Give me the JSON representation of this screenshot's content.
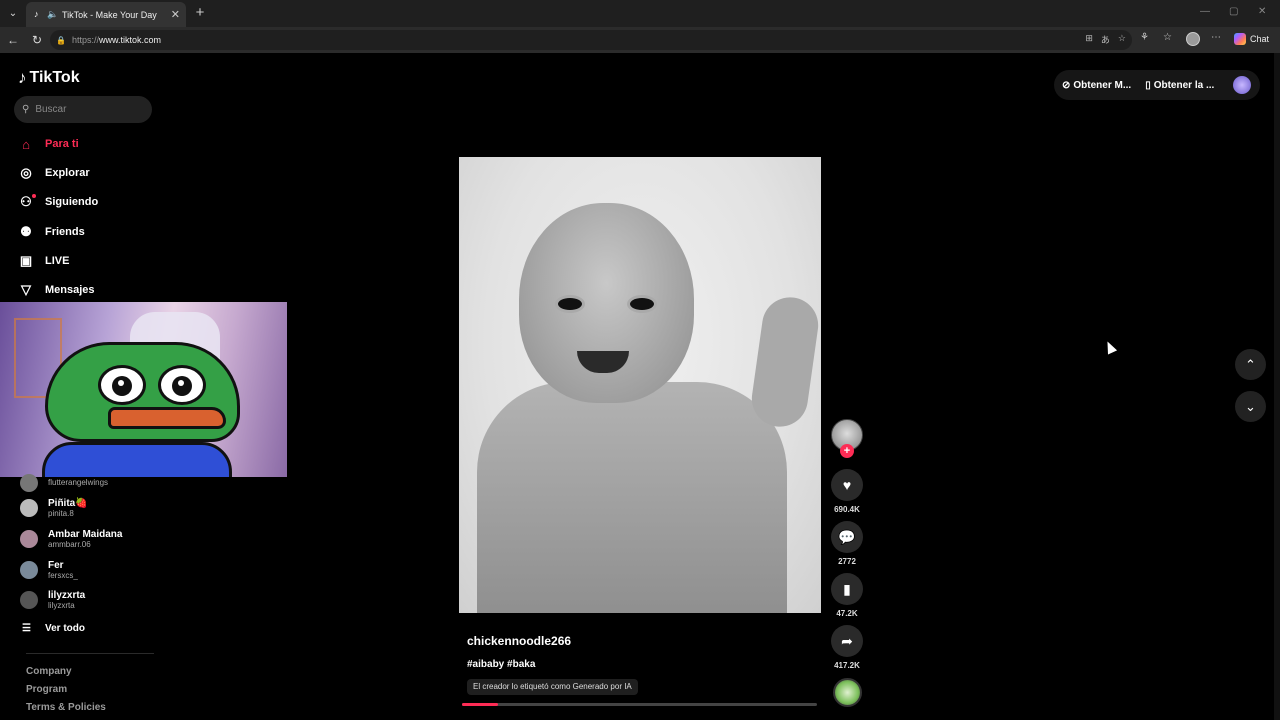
{
  "browser": {
    "tab_title": "TikTok - Make Your Day",
    "url_protocol": "https://",
    "url_host": "www.tiktok.com",
    "chat_label": "Chat"
  },
  "tiktok": {
    "logo_text": "TikTok",
    "search_placeholder": "Buscar",
    "menu": [
      {
        "label": "Para ti",
        "icon": "home-icon",
        "active": true
      },
      {
        "label": "Explorar",
        "icon": "compass-icon"
      },
      {
        "label": "Siguiendo",
        "icon": "following-icon"
      },
      {
        "label": "Friends",
        "icon": "friends-icon"
      },
      {
        "label": "LIVE",
        "icon": "live-icon"
      },
      {
        "label": "Mensajes",
        "icon": "messages-icon"
      }
    ],
    "following": [
      {
        "name": "",
        "handle": "flutterangelwings"
      },
      {
        "name": "Piñita🍓",
        "handle": "pinita.8"
      },
      {
        "name": "Ambar Maidana",
        "handle": "ammbarr.06"
      },
      {
        "name": "Fer",
        "handle": "fersxcs_"
      },
      {
        "name": "lilyzxrta",
        "handle": "lilyzxrta"
      }
    ],
    "see_all": "Ver todo",
    "footer": [
      "Company",
      "Program",
      "Terms & Policies"
    ],
    "top_right": {
      "coins": "Obtener M...",
      "app": "Obtener la ..."
    },
    "video": {
      "author": "chickennoodle266",
      "hashtags": "#aibaby #baka",
      "ai_label": "El creador lo etiquetó como Generado por IA",
      "progress": 0.1
    },
    "actions": {
      "likes": "690.4K",
      "comments": "2772",
      "saves": "47.2K",
      "shares": "417.2K"
    }
  },
  "colors": {
    "accent": "#fe2c55",
    "background": "#000000"
  }
}
